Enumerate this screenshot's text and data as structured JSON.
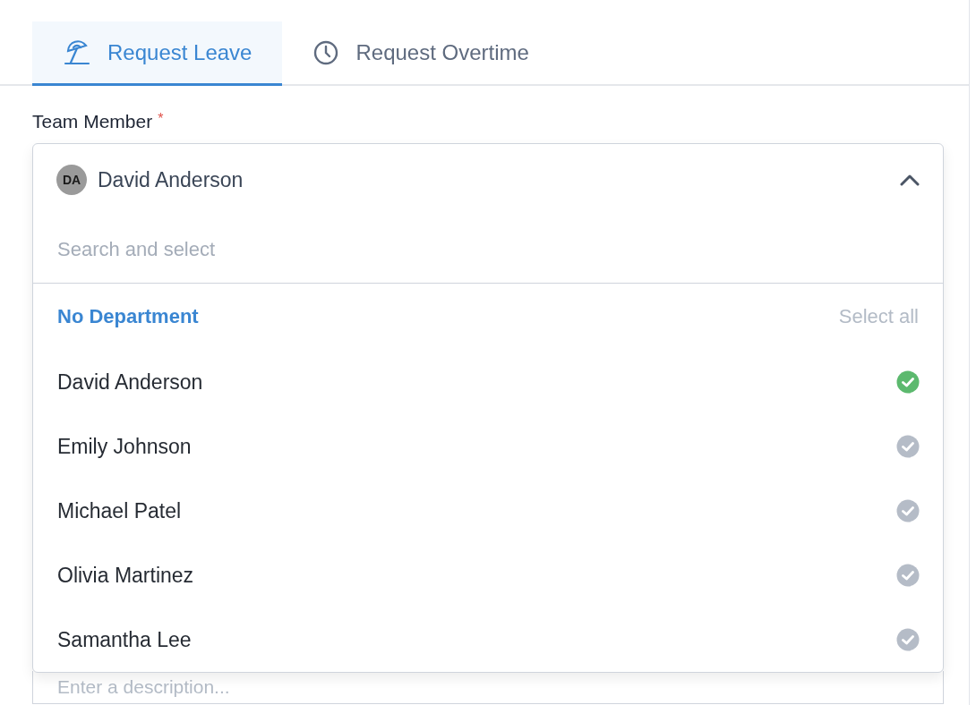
{
  "tabs": [
    {
      "label": "Request Leave",
      "selected": true
    },
    {
      "label": "Request Overtime",
      "selected": false
    }
  ],
  "team_member": {
    "label": "Team Member",
    "required_mark": "*",
    "avatar_initials": "DA",
    "value": "David Anderson",
    "expanded": true,
    "search_placeholder": "Search and select"
  },
  "group": {
    "name": "No Department",
    "select_all": "Select all"
  },
  "members": [
    {
      "name": "David Anderson",
      "selected": true
    },
    {
      "name": "Emily Johnson",
      "selected": false
    },
    {
      "name": "Michael Patel",
      "selected": false
    },
    {
      "name": "Olivia Martinez",
      "selected": false
    },
    {
      "name": "Samantha Lee",
      "selected": false
    }
  ],
  "description": {
    "placeholder": "Enter a description..."
  }
}
